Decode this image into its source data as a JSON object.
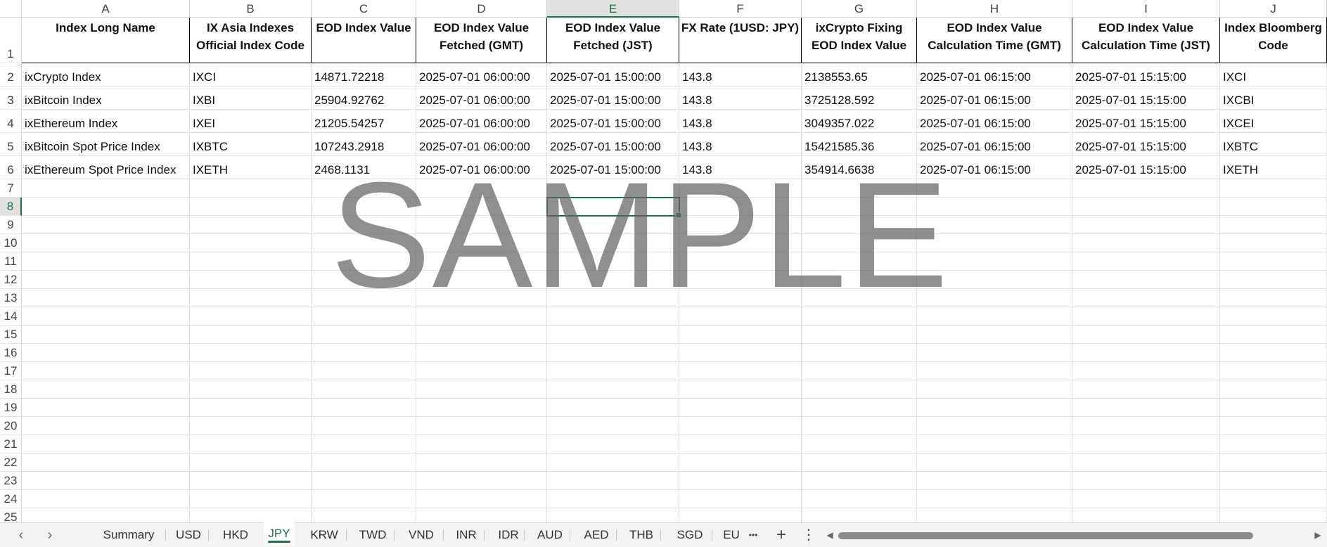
{
  "columns": [
    "A",
    "B",
    "C",
    "D",
    "E",
    "F",
    "G",
    "H",
    "I",
    "J"
  ],
  "rows": [
    "1",
    "2",
    "3",
    "4",
    "5",
    "6",
    "7",
    "8",
    "9",
    "10",
    "11",
    "12",
    "13",
    "14",
    "15",
    "16",
    "17",
    "18",
    "19",
    "20",
    "21",
    "22",
    "23",
    "24",
    "25"
  ],
  "selected_column": "E",
  "selected_row": "8",
  "headers": [
    "Index Long Name",
    "IX Asia Indexes Official Index Code",
    "EOD Index Value",
    "EOD Index Value Fetched (GMT)",
    "EOD Index Value Fetched (JST)",
    "FX Rate (1USD: JPY)",
    "ixCrypto Fixing EOD Index Value",
    "EOD Index Value Calculation Time (GMT)",
    "EOD Index Value Calculation Time (JST)",
    "Index Bloomberg Code"
  ],
  "table_rows": [
    [
      "ixCrypto Index",
      "IXCI",
      "14871.72218",
      "2025-07-01 06:00:00",
      "2025-07-01 15:00:00",
      "143.8",
      "2138553.65",
      "2025-07-01 06:15:00",
      "2025-07-01 15:15:00",
      "IXCI"
    ],
    [
      "ixBitcoin Index",
      "IXBI",
      "25904.92762",
      "2025-07-01 06:00:00",
      "2025-07-01 15:00:00",
      "143.8",
      "3725128.592",
      "2025-07-01 06:15:00",
      "2025-07-01 15:15:00",
      "IXCBI"
    ],
    [
      "ixEthereum Index",
      "IXEI",
      "21205.54257",
      "2025-07-01 06:00:00",
      "2025-07-01 15:00:00",
      "143.8",
      "3049357.022",
      "2025-07-01 06:15:00",
      "2025-07-01 15:15:00",
      "IXCEI"
    ],
    [
      "ixBitcoin Spot Price Index",
      "IXBTC",
      "107243.2918",
      "2025-07-01 06:00:00",
      "2025-07-01 15:00:00",
      "143.8",
      "15421585.36",
      "2025-07-01 06:15:00",
      "2025-07-01 15:15:00",
      "IXBTC"
    ],
    [
      "ixEthereum Spot Price Index",
      "IXETH",
      "2468.1131",
      "2025-07-01 06:00:00",
      "2025-07-01 15:00:00",
      "143.8",
      "354914.6638",
      "2025-07-01 06:15:00",
      "2025-07-01 15:15:00",
      "IXETH"
    ]
  ],
  "watermark": "SAMPLE",
  "sheet_tabs": [
    "Summary",
    "USD",
    "HKD",
    "JPY",
    "KRW",
    "TWD",
    "VND",
    "INR",
    "IDR",
    "AUD",
    "AED",
    "THB",
    "SGD",
    "EU"
  ],
  "active_tab": "JPY",
  "tab_more": "•••",
  "tab_add": "+",
  "tab_menu": "⋮",
  "nav_prev": "‹",
  "nav_next": "›",
  "colors": {
    "accent": "#1e7145",
    "watermark": "#6b6b6b"
  }
}
